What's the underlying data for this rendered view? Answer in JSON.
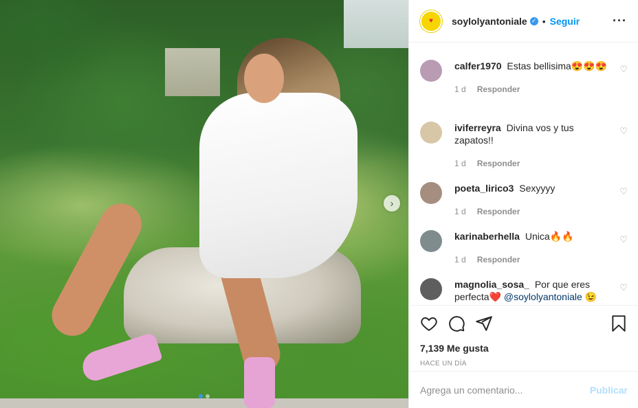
{
  "post": {
    "author": {
      "username": "soylolyantoniale",
      "verified_icon": "verified-badge-icon",
      "separator": "•",
      "follow_label": "Seguir",
      "more_icon": "more-options-icon"
    },
    "comments": [
      {
        "username": "calfer1970",
        "text": "Estas bellisima😍😍😍",
        "age": "1 d",
        "reply_label": "Responder",
        "avatar_color": "#b99cb3"
      },
      {
        "username": "iviferreyra",
        "text": "Divina vos y tus zapatos!!",
        "age": "1 d",
        "reply_label": "Responder",
        "avatar_color": "#d8c7a6"
      },
      {
        "username": "poeta_lirico3",
        "text": "Sexyyyy",
        "age": "1 d",
        "reply_label": "Responder",
        "avatar_color": "#a58d7f"
      },
      {
        "username": "karinaberhella",
        "text": "Unica🔥🔥",
        "age": "1 d",
        "reply_label": "Responder",
        "avatar_color": "#7f8c8d"
      },
      {
        "username": "magnolia_sosa_",
        "text": "Por que eres perfecta❤️",
        "mention": "@soylolyantoniale",
        "emoji_after": "😉",
        "avatar_color": "#5e5e5e"
      }
    ],
    "actions": {
      "like_icon": "heart-outline-icon",
      "comment_icon": "comment-icon",
      "share_icon": "share-icon",
      "save_icon": "bookmark-icon"
    },
    "likes_text": "7,139 Me gusta",
    "time_text": "HACE UN DÍA",
    "add_comment": {
      "placeholder": "Agrega un comentario...",
      "publish_label": "Publicar"
    },
    "carousel": {
      "slide_count": 2,
      "active_index": 0,
      "next_icon": "chevron-right-icon"
    },
    "colors": {
      "accent": "#0095f6",
      "verified": "#3897f0",
      "publish_disabled": "#b2dffc",
      "muted": "#8e8e8e"
    }
  }
}
